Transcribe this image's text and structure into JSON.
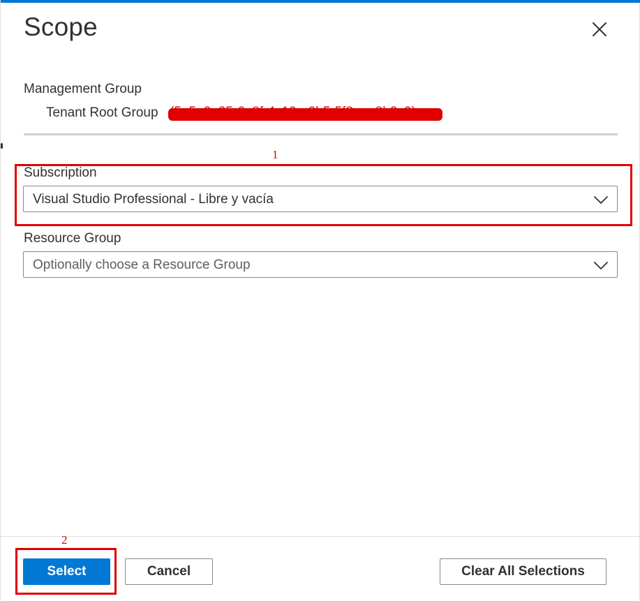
{
  "panel": {
    "title": "Scope",
    "close_icon": "close-icon"
  },
  "management_group": {
    "label": "Management Group",
    "value": "Tenant Root Group",
    "redacted_id": "(5a5e0e25-6a8f-4c19-a2b5-5f8aaa8b9c0)"
  },
  "subscription": {
    "label": "Subscription",
    "value": "Visual Studio Professional - Libre y vacía",
    "chevron_icon": "chevron-down-icon"
  },
  "resource_group": {
    "label": "Resource Group",
    "placeholder": "Optionally choose a Resource Group",
    "chevron_icon": "chevron-down-icon"
  },
  "footer": {
    "select_label": "Select",
    "cancel_label": "Cancel",
    "clear_label": "Clear All Selections"
  },
  "annotations": {
    "first": "1",
    "second": "2"
  },
  "colors": {
    "accent": "#0078d4",
    "annotation": "#e00000",
    "text": "#323130",
    "placeholder": "#605e5c"
  }
}
